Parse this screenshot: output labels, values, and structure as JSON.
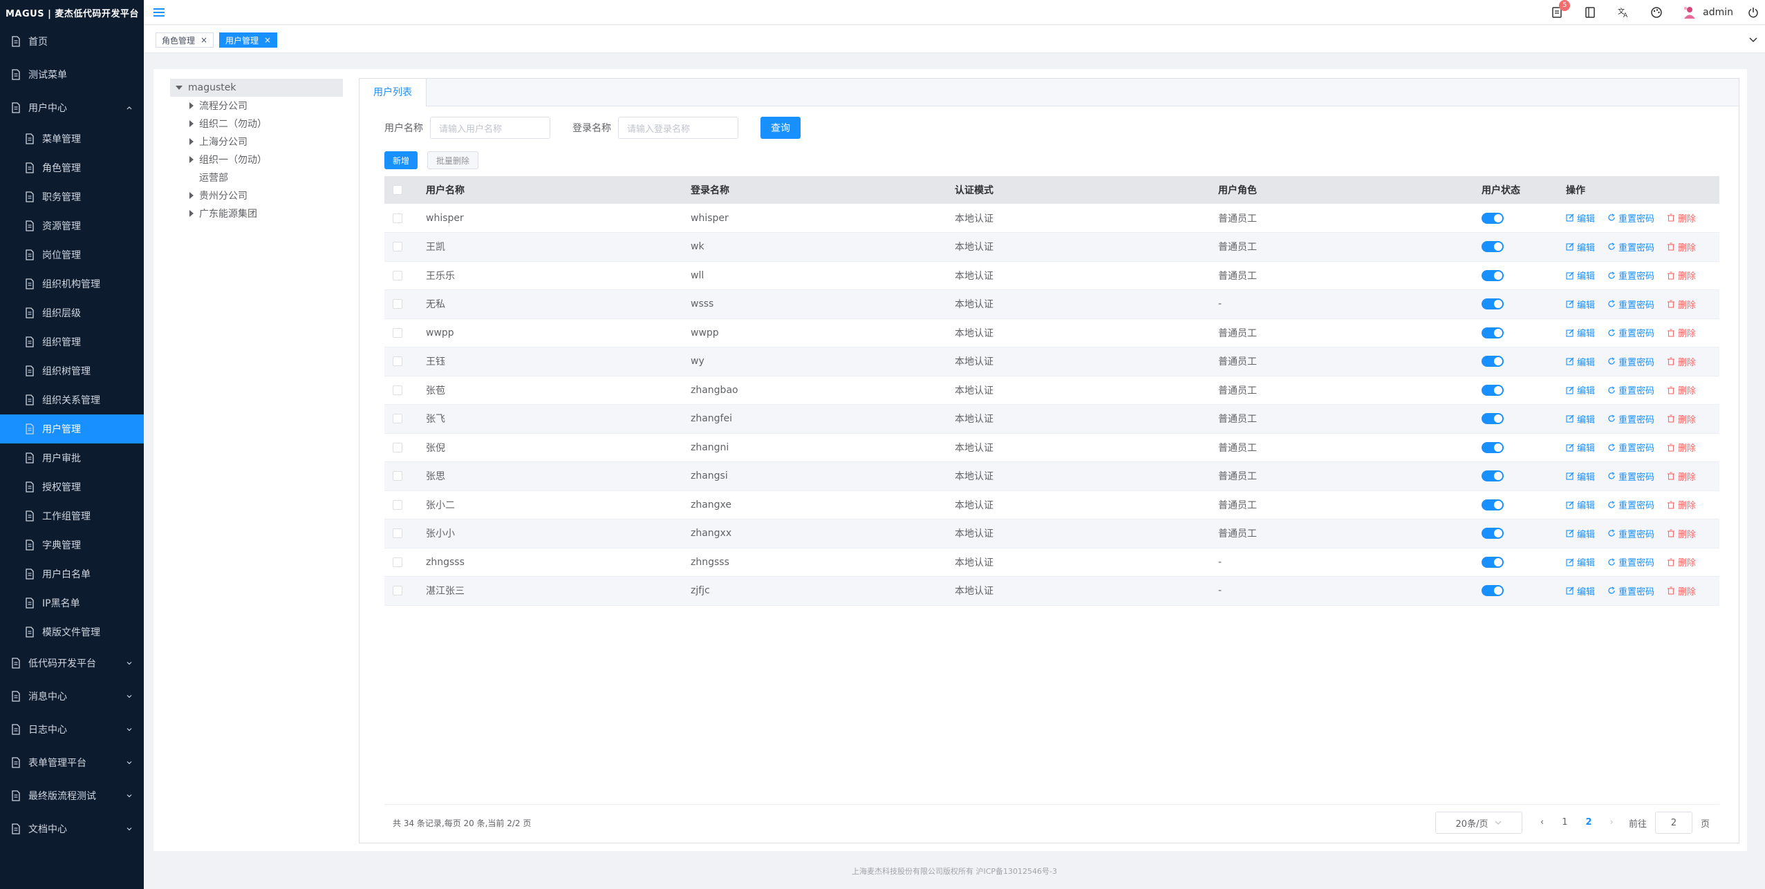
{
  "app": {
    "logo_text": "MAGUS | 麦杰低代码开发平台"
  },
  "header": {
    "badge_count": "5",
    "username": "admin"
  },
  "tags": [
    {
      "label": "角色管理"
    },
    {
      "label": "用户管理"
    }
  ],
  "sidebar": {
    "items": [
      {
        "label": "首页",
        "level": "top"
      },
      {
        "label": "测试菜单",
        "level": "top"
      },
      {
        "label": "用户中心",
        "level": "top",
        "expanded": true
      },
      {
        "label": "菜单管理",
        "level": "sub"
      },
      {
        "label": "角色管理",
        "level": "sub"
      },
      {
        "label": "职务管理",
        "level": "sub"
      },
      {
        "label": "资源管理",
        "level": "sub"
      },
      {
        "label": "岗位管理",
        "level": "sub"
      },
      {
        "label": "组织机构管理",
        "level": "sub"
      },
      {
        "label": "组织层级",
        "level": "sub"
      },
      {
        "label": "组织管理",
        "level": "sub"
      },
      {
        "label": "组织树管理",
        "level": "sub"
      },
      {
        "label": "组织关系管理",
        "level": "sub"
      },
      {
        "label": "用户管理",
        "level": "sub",
        "active": true
      },
      {
        "label": "用户审批",
        "level": "sub"
      },
      {
        "label": "授权管理",
        "level": "sub"
      },
      {
        "label": "工作组管理",
        "level": "sub"
      },
      {
        "label": "字典管理",
        "level": "sub"
      },
      {
        "label": "用户白名单",
        "level": "sub"
      },
      {
        "label": "IP黑名单",
        "level": "sub"
      },
      {
        "label": "模版文件管理",
        "level": "sub"
      },
      {
        "label": "低代码开发平台",
        "level": "top",
        "expandable": true
      },
      {
        "label": "消息中心",
        "level": "top",
        "expandable": true
      },
      {
        "label": "日志中心",
        "level": "top",
        "expandable": true
      },
      {
        "label": "表单管理平台",
        "level": "top",
        "expandable": true
      },
      {
        "label": "最终版流程测试",
        "level": "top",
        "expandable": true
      },
      {
        "label": "文档中心",
        "level": "top",
        "expandable": true
      }
    ]
  },
  "tree": {
    "root": "magustek",
    "children": [
      {
        "label": "流程分公司",
        "has_children": true
      },
      {
        "label": "组织二（勿动）",
        "has_children": true
      },
      {
        "label": "上海分公司",
        "has_children": true
      },
      {
        "label": "组织一（勿动）",
        "has_children": true
      },
      {
        "label": "运营部",
        "has_children": false
      },
      {
        "label": "贵州分公司",
        "has_children": true
      },
      {
        "label": "广东能源集团",
        "has_children": true
      }
    ]
  },
  "panel": {
    "tab": "用户列表"
  },
  "search": {
    "username_label": "用户名称",
    "username_placeholder": "请输入用户名称",
    "login_label": "登录名称",
    "login_placeholder": "请输入登录名称",
    "query_button": "查询"
  },
  "actions": {
    "add": "新增",
    "batch_delete": "批量删除"
  },
  "table": {
    "headers": [
      "用户名称",
      "登录名称",
      "认证模式",
      "用户角色",
      "用户状态",
      "操作"
    ],
    "op_labels": {
      "edit": "编辑",
      "reset": "重置密码",
      "delete": "删除"
    },
    "rows": [
      [
        "whisper",
        "whisper",
        "本地认证",
        "普通员工"
      ],
      [
        "王凯",
        "wk",
        "本地认证",
        "普通员工"
      ],
      [
        "王乐乐",
        "wll",
        "本地认证",
        "普通员工"
      ],
      [
        "无私",
        "wsss",
        "本地认证",
        "-"
      ],
      [
        "wwpp",
        "wwpp",
        "本地认证",
        "普通员工"
      ],
      [
        "王钰",
        "wy",
        "本地认证",
        "普通员工"
      ],
      [
        "张苞",
        "zhangbao",
        "本地认证",
        "普通员工"
      ],
      [
        "张飞",
        "zhangfei",
        "本地认证",
        "普通员工"
      ],
      [
        "张倪",
        "zhangni",
        "本地认证",
        "普通员工"
      ],
      [
        "张思",
        "zhangsi",
        "本地认证",
        "普通员工"
      ],
      [
        "张小二",
        "zhangxe",
        "本地认证",
        "普通员工"
      ],
      [
        "张小小",
        "zhangxx",
        "本地认证",
        "普通员工"
      ],
      [
        "zhngsss",
        "zhngsss",
        "本地认证",
        "-"
      ],
      [
        "湛江张三",
        "zjfjc",
        "本地认证",
        "-"
      ]
    ]
  },
  "pagination": {
    "summary": "共 34 条记录,每页 20 条,当前 2/2 页",
    "page_size": "20条/页",
    "pages": [
      "1",
      "2"
    ],
    "current_page": "2",
    "goto_label": "前往",
    "goto_value": "2",
    "goto_suffix": "页"
  },
  "footer": {
    "text": "上海麦杰科技股份有限公司版权所有    沪ICP备13012546号-3"
  }
}
